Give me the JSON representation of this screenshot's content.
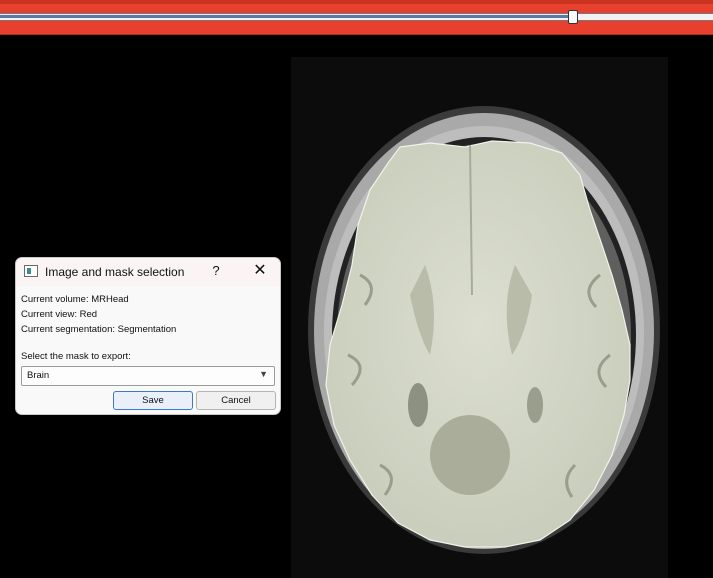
{
  "slider": {
    "position_fraction": 0.804,
    "colors": {
      "bar": "#e8402f",
      "fill": "#5a79a8"
    }
  },
  "viewer": {
    "image": "axial MRI slice of head with brain segmentation overlay",
    "overlay_color": "#d8dccb"
  },
  "dialog": {
    "icon": "app-window-icon",
    "title": "Image and mask selection",
    "help_label": "?",
    "close_label": "✕",
    "current_volume": "Current volume: MRHead",
    "current_view": "Current view: Red",
    "current_segmentation": "Current segmentation: Segmentation",
    "mask_prompt": "Select the mask to export:",
    "mask_selected": "Brain",
    "save_label": "Save",
    "cancel_label": "Cancel"
  }
}
